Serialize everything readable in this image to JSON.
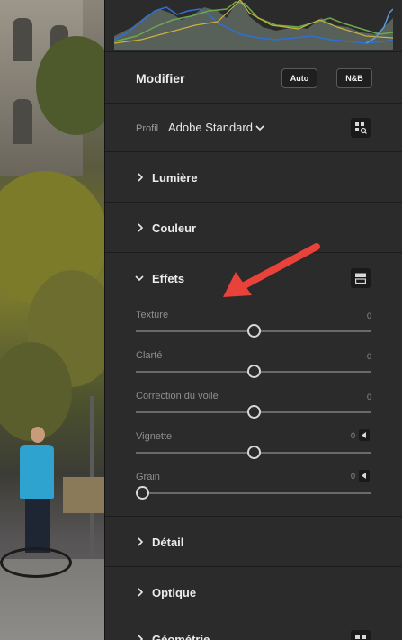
{
  "panel": {
    "modifier": {
      "title": "Modifier",
      "auto_label": "Auto",
      "bw_label": "N&B"
    },
    "profil": {
      "label": "Profil",
      "value": "Adobe Standard"
    },
    "sections": {
      "lumiere": "Lumière",
      "couleur": "Couleur",
      "effets": "Effets",
      "detail": "Détail",
      "optique": "Optique",
      "geometrie": "Géométrie"
    },
    "sliders": [
      {
        "label": "Texture",
        "value": "0",
        "position": 0.5
      },
      {
        "label": "Clarté",
        "value": "0",
        "position": 0.5
      },
      {
        "label": "Correction du voile",
        "value": "0",
        "position": 0.5
      },
      {
        "label": "Vignette",
        "value": "0",
        "position": 0.5
      },
      {
        "label": "Grain",
        "value": "0",
        "position": 0.0
      }
    ]
  },
  "colors": {
    "panel_bg": "#2b2b2b",
    "annotation_arrow": "#e8423a",
    "histogram_blue": "#2f6fd6",
    "histogram_green": "#6aa84f",
    "histogram_yellow": "#c9b13a"
  }
}
